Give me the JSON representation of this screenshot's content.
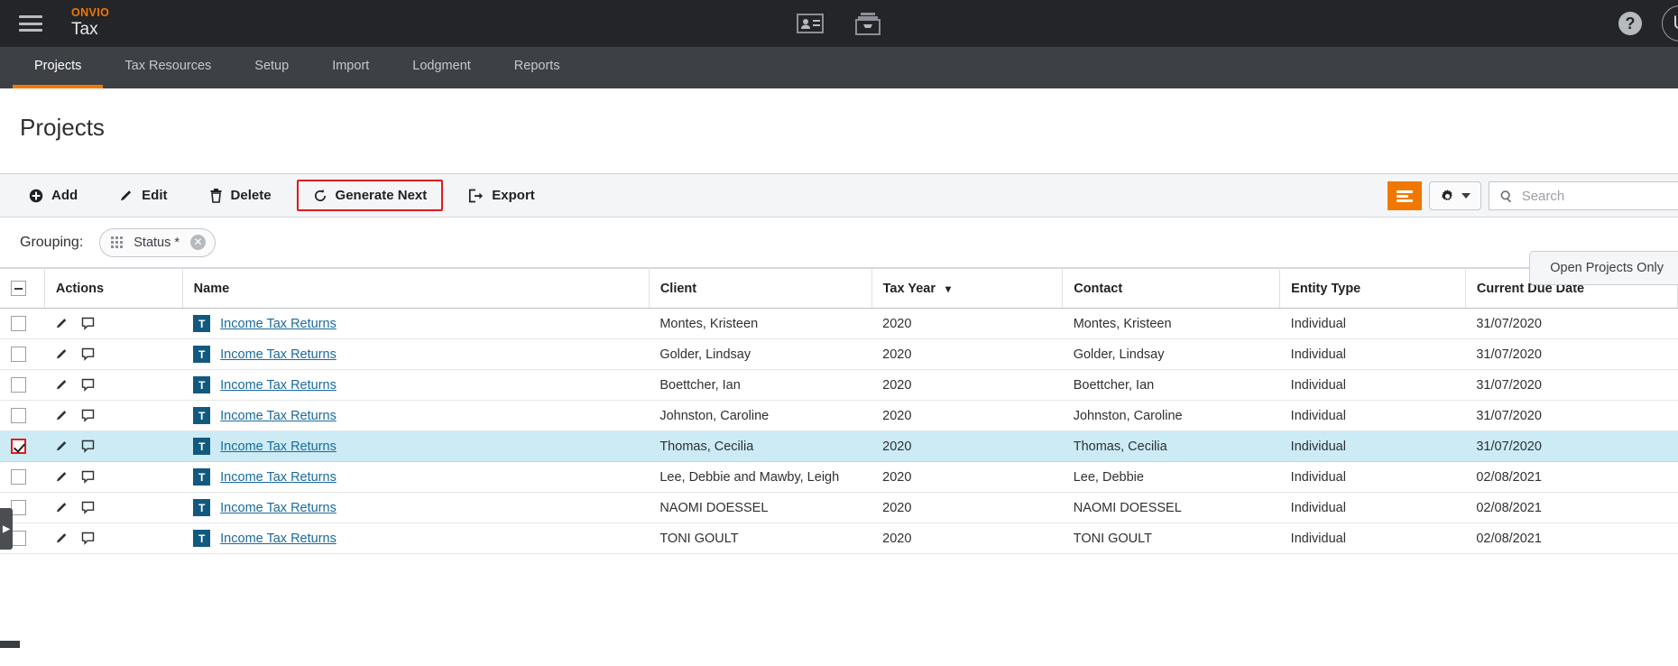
{
  "header": {
    "menu_icon": "hamburger-icon",
    "brand_top": "ONVIO",
    "brand_sub": "Tax",
    "center_icons": [
      "contact-card-icon",
      "file-box-icon"
    ],
    "help_label": "?",
    "avatar_label": "U"
  },
  "nav": {
    "tabs": [
      {
        "label": "Projects",
        "active": true
      },
      {
        "label": "Tax Resources",
        "active": false
      },
      {
        "label": "Setup",
        "active": false
      },
      {
        "label": "Import",
        "active": false
      },
      {
        "label": "Lodgment",
        "active": false
      },
      {
        "label": "Reports",
        "active": false
      }
    ]
  },
  "page": {
    "title": "Projects",
    "open_projects_filter": "Open Projects Only"
  },
  "toolbar": {
    "buttons": [
      {
        "label": "Add",
        "icon": "plus-circle-icon",
        "highlighted": false
      },
      {
        "label": "Edit",
        "icon": "pencil-icon",
        "highlighted": false
      },
      {
        "label": "Delete",
        "icon": "trash-icon",
        "highlighted": false
      },
      {
        "label": "Generate Next",
        "icon": "refresh-icon",
        "highlighted": true
      },
      {
        "label": "Export",
        "icon": "export-icon",
        "highlighted": false
      }
    ],
    "group_toggle_icon": "list-lines-icon",
    "gear_icon": "gear-icon",
    "search_placeholder": "Search",
    "search_value": ""
  },
  "grouping": {
    "label": "Grouping:",
    "chip_label": "Status *",
    "chip_icon": "grid-dots-icon",
    "chip_remove_icon": "close-circle-icon"
  },
  "table": {
    "columns": [
      "Actions",
      "Name",
      "Client",
      "Tax Year",
      "Contact",
      "Entity Type",
      "Current Due Date"
    ],
    "sorted_column": "Tax Year",
    "sort_icon": "chevron-down-icon",
    "header_checkbox_state": "indeterminate",
    "rows": [
      {
        "checked": false,
        "selected": false,
        "badge": "T",
        "name": "Income Tax Returns",
        "client": "Montes, Kristeen",
        "tax_year": "2020",
        "contact": "Montes, Kristeen",
        "entity_type": "Individual",
        "due_date": "31/07/2020"
      },
      {
        "checked": false,
        "selected": false,
        "badge": "T",
        "name": "Income Tax Returns",
        "client": "Golder, Lindsay",
        "tax_year": "2020",
        "contact": "Golder, Lindsay",
        "entity_type": "Individual",
        "due_date": "31/07/2020"
      },
      {
        "checked": false,
        "selected": false,
        "badge": "T",
        "name": "Income Tax Returns",
        "client": "Boettcher, Ian",
        "tax_year": "2020",
        "contact": "Boettcher, Ian",
        "entity_type": "Individual",
        "due_date": "31/07/2020"
      },
      {
        "checked": false,
        "selected": false,
        "badge": "T",
        "name": "Income Tax Returns",
        "client": "Johnston, Caroline",
        "tax_year": "2020",
        "contact": "Johnston, Caroline",
        "entity_type": "Individual",
        "due_date": "31/07/2020"
      },
      {
        "checked": true,
        "selected": true,
        "badge": "T",
        "name": "Income Tax Returns",
        "client": "Thomas, Cecilia",
        "tax_year": "2020",
        "contact": "Thomas, Cecilia",
        "entity_type": "Individual",
        "due_date": "31/07/2020"
      },
      {
        "checked": false,
        "selected": false,
        "badge": "T",
        "name": "Income Tax Returns",
        "client": "Lee, Debbie and Mawby, Leigh",
        "tax_year": "2020",
        "contact": "Lee, Debbie",
        "entity_type": "Individual",
        "due_date": "02/08/2021"
      },
      {
        "checked": false,
        "selected": false,
        "badge": "T",
        "name": "Income Tax Returns",
        "client": "NAOMI DOESSEL",
        "tax_year": "2020",
        "contact": "NAOMI DOESSEL",
        "entity_type": "Individual",
        "due_date": "02/08/2021"
      },
      {
        "checked": false,
        "selected": false,
        "badge": "T",
        "name": "Income Tax Returns",
        "client": "TONI GOULT",
        "tax_year": "2020",
        "contact": "TONI GOULT",
        "entity_type": "Individual",
        "due_date": "02/08/2021"
      }
    ]
  },
  "colors": {
    "accent_orange": "#f07800",
    "highlight_red": "#e01b1b",
    "selected_row": "#ccebf5",
    "link_blue": "#1a6a9c",
    "badge_blue": "#12597f",
    "topbar": "#232528",
    "navbar": "#3d4045"
  }
}
